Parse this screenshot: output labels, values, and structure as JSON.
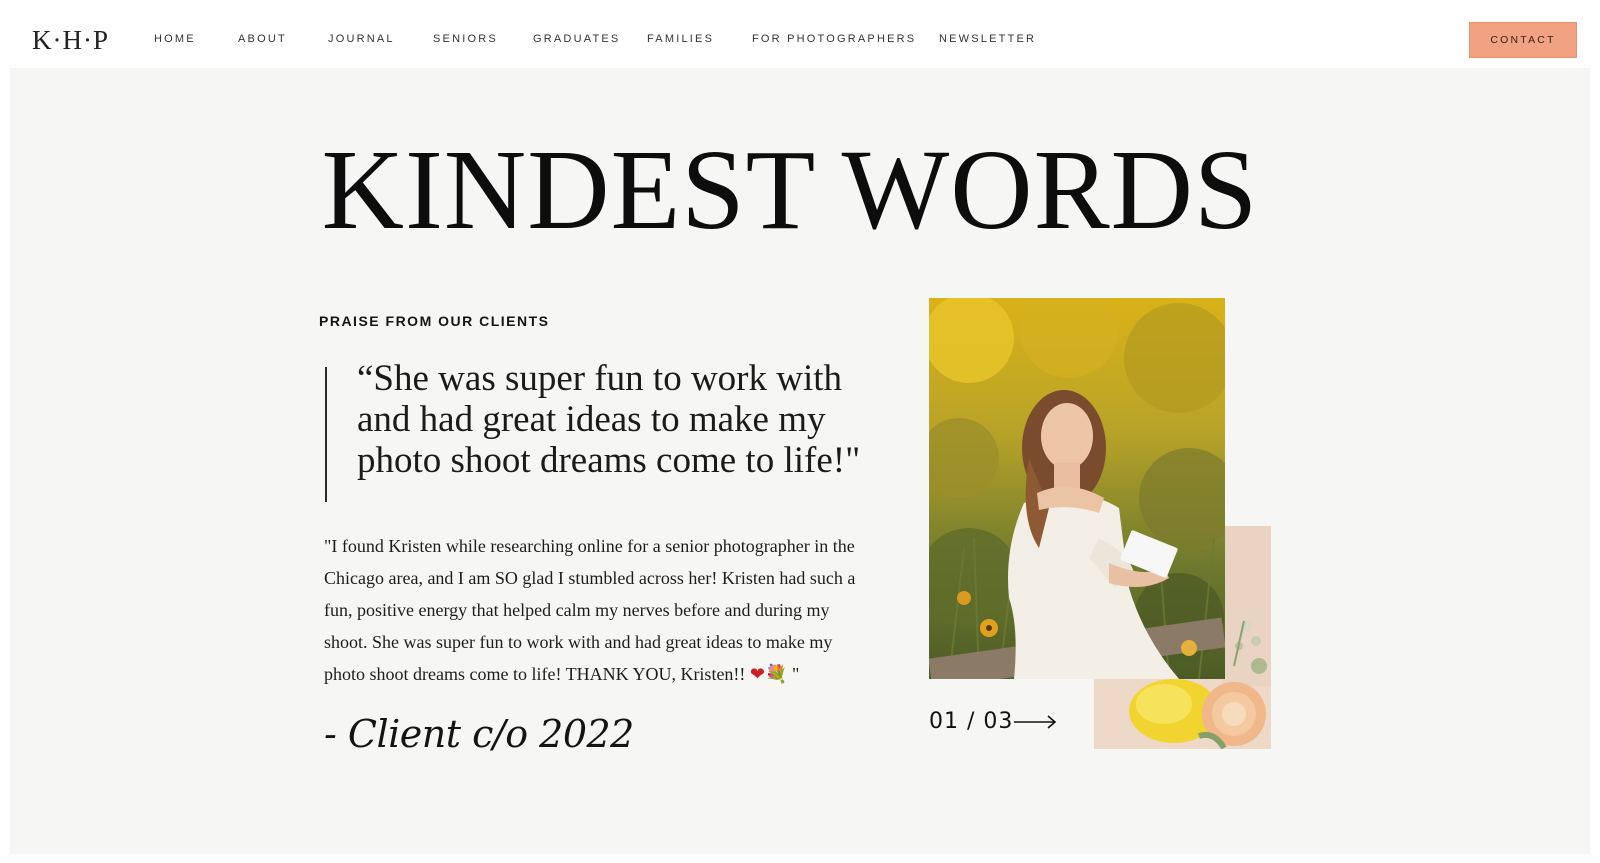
{
  "brand": {
    "logo_text": "K·H·P",
    "accent_color": "#f0a283"
  },
  "nav": {
    "items": [
      {
        "label": "HOME"
      },
      {
        "label": "ABOUT"
      },
      {
        "label": "JOURNAL"
      },
      {
        "label": "SENIORS"
      },
      {
        "label": "GRADUATES"
      },
      {
        "label": "FAMILIES"
      },
      {
        "label": "FOR PHOTOGRAPHERS"
      },
      {
        "label": "NEWSLETTER"
      }
    ],
    "contact_label": "CONTACT"
  },
  "section": {
    "title": "KINDEST WORDS",
    "eyebrow": "PRAISE FROM OUR CLIENTS",
    "pull_quote_lines": [
      "“She was super fun to work with",
      "and had great ideas to make my",
      "photo shoot dreams come to life!\""
    ],
    "body_lines": [
      "\"I found Kristen while researching online for a senior photographer in the",
      "Chicago area, and I am SO glad I stumbled across her! Kristen had such a",
      "fun, positive energy that helped calm my nerves before and during my",
      "shoot. She was super fun to work with and had great ideas to make my",
      "photo shoot dreams come to life! THANK YOU, Kristen!!"
    ],
    "body_emoji": {
      "heart": "❤",
      "flowers": "💐"
    },
    "body_close": " \"",
    "signature": "- Client c/o 2022",
    "slider_counter": "01 / 03",
    "icons": {
      "next": "arrow-right-icon"
    }
  }
}
